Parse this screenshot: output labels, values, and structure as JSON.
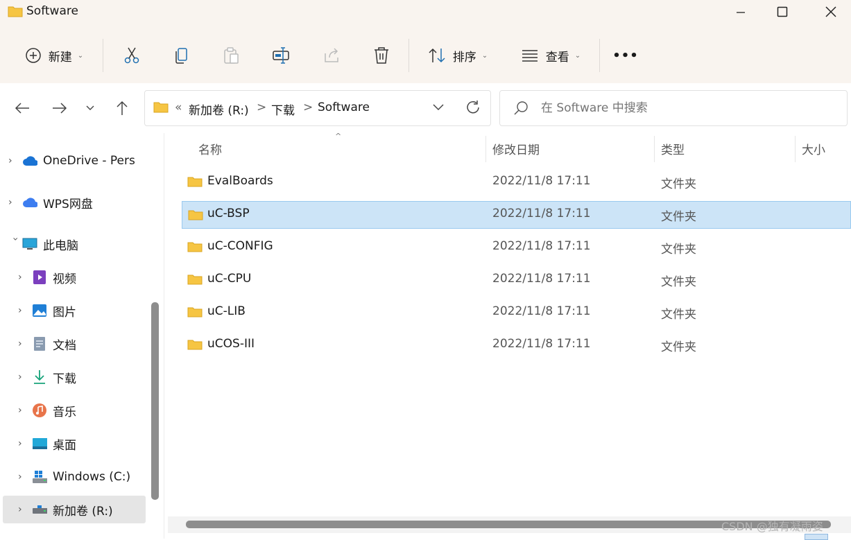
{
  "window": {
    "title": "Software"
  },
  "toolbar": {
    "new_label": "新建",
    "sort_label": "排序",
    "view_label": "查看",
    "more_label": "•••"
  },
  "address": {
    "overflow": "«",
    "crumbs": [
      "新加卷 (R:)",
      "下载",
      "Software"
    ],
    "separator": ">"
  },
  "search": {
    "placeholder": "在 Software 中搜索"
  },
  "sidebar": {
    "items": [
      {
        "label": "OneDrive - Pers",
        "icon": "cloud-icon",
        "expand": ">"
      },
      {
        "label": "WPS网盘",
        "icon": "wps-cloud-icon",
        "expand": ">"
      },
      {
        "label": "此电脑",
        "icon": "computer-icon",
        "expand": "v"
      },
      {
        "label": "视频",
        "icon": "video-icon",
        "expand": ">"
      },
      {
        "label": "图片",
        "icon": "pictures-icon",
        "expand": ">"
      },
      {
        "label": "文档",
        "icon": "documents-icon",
        "expand": ">"
      },
      {
        "label": "下载",
        "icon": "download-icon",
        "expand": ">"
      },
      {
        "label": "音乐",
        "icon": "music-icon",
        "expand": ">"
      },
      {
        "label": "桌面",
        "icon": "desktop-icon",
        "expand": ">"
      },
      {
        "label": "Windows (C:)",
        "icon": "windows-drive-icon",
        "expand": ">"
      },
      {
        "label": "新加卷 (R:)",
        "icon": "drive-icon",
        "expand": ">"
      }
    ]
  },
  "columns": {
    "name": "名称",
    "modified": "修改日期",
    "type": "类型",
    "size": "大小"
  },
  "files": [
    {
      "name": "EvalBoards",
      "modified": "2022/11/8 17:11",
      "type": "文件夹"
    },
    {
      "name": "uC-BSP",
      "modified": "2022/11/8 17:11",
      "type": "文件夹"
    },
    {
      "name": "uC-CONFIG",
      "modified": "2022/11/8 17:11",
      "type": "文件夹"
    },
    {
      "name": "uC-CPU",
      "modified": "2022/11/8 17:11",
      "type": "文件夹"
    },
    {
      "name": "uC-LIB",
      "modified": "2022/11/8 17:11",
      "type": "文件夹"
    },
    {
      "name": "uCOS-III",
      "modified": "2022/11/8 17:11",
      "type": "文件夹"
    }
  ],
  "selected_file": "uC-BSP",
  "selected_sidebar": "新加卷 (R:)",
  "watermark": "CSDN @独有凝雨姿",
  "colors": {
    "folder": "#f6c543",
    "selection": "#cce4f7",
    "chrome": "#f9f4ef"
  }
}
